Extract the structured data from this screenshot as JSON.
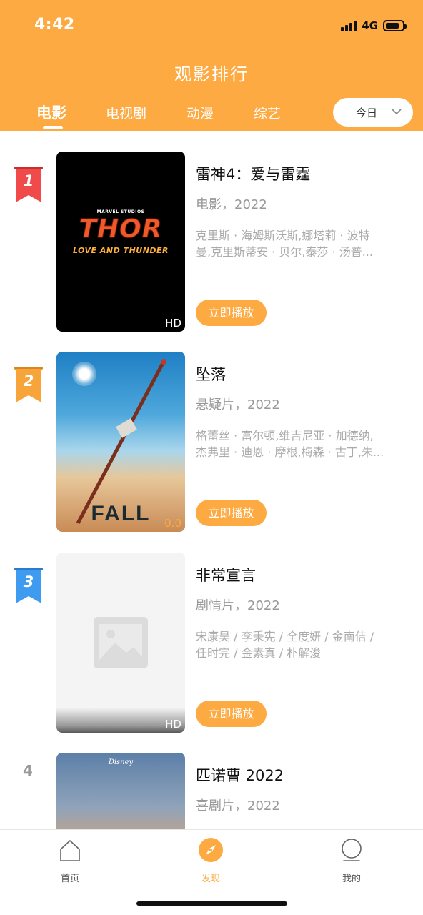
{
  "status_bar": {
    "time": "4:42",
    "network": "4G",
    "battery_level": 0.7
  },
  "header": {
    "title": "观影排行"
  },
  "tabs": [
    {
      "label": "电影",
      "active": true
    },
    {
      "label": "电视剧",
      "active": false
    },
    {
      "label": "动漫",
      "active": false
    },
    {
      "label": "综艺",
      "active": false
    }
  ],
  "date_filter": {
    "selected": "今日",
    "icon": "chevron-down-icon"
  },
  "items": [
    {
      "rank": "1",
      "rank_color": "#F04A4A",
      "title": "雷神4：爱与雷霆",
      "meta": "电影，2022",
      "cast": [
        "克里斯 · 海姆斯沃斯,娜塔莉 · 波特",
        "曼,克里斯蒂安 · 贝尔,泰莎 · 汤普..."
      ],
      "play_label": "立即播放",
      "poster": {
        "studio": "MARVEL STUDIOS",
        "logo_line1": "THOR",
        "logo_line2": "LOVE AND THUNDER",
        "quality": "HD"
      }
    },
    {
      "rank": "2",
      "rank_color": "#F7A53A",
      "title": "坠落",
      "meta": "悬疑片，2022",
      "cast": [
        "格蕾丝 · 富尔顿,维吉尼亚 · 加德纳,",
        "杰弗里 · 迪恩 · 摩根,梅森 · 古丁,朱..."
      ],
      "play_label": "立即播放",
      "poster": {
        "logo": "FALL",
        "quality": "0.0"
      }
    },
    {
      "rank": "3",
      "rank_color": "#3E9BF0",
      "title": "非常宣言",
      "meta": "剧情片，2022",
      "cast": [
        "宋康昊 / 李秉宪 / 全度妍 / 金南佶 /",
        "任时完 / 金素真 / 朴解浚"
      ],
      "play_label": "立即播放",
      "poster": {
        "quality": "HD",
        "placeholder_icon": "image-placeholder-icon"
      }
    },
    {
      "rank": "4",
      "title": "匹诺曹 2022",
      "meta": "喜剧片，2022",
      "poster": {
        "studio": "Disney"
      }
    }
  ],
  "tabbar": [
    {
      "label": "首页",
      "icon": "home-icon",
      "active": false
    },
    {
      "label": "发现",
      "icon": "compass-icon",
      "active": true
    },
    {
      "label": "我的",
      "icon": "profile-icon",
      "active": false
    }
  ],
  "colors": {
    "accent": "#FDAA43"
  }
}
